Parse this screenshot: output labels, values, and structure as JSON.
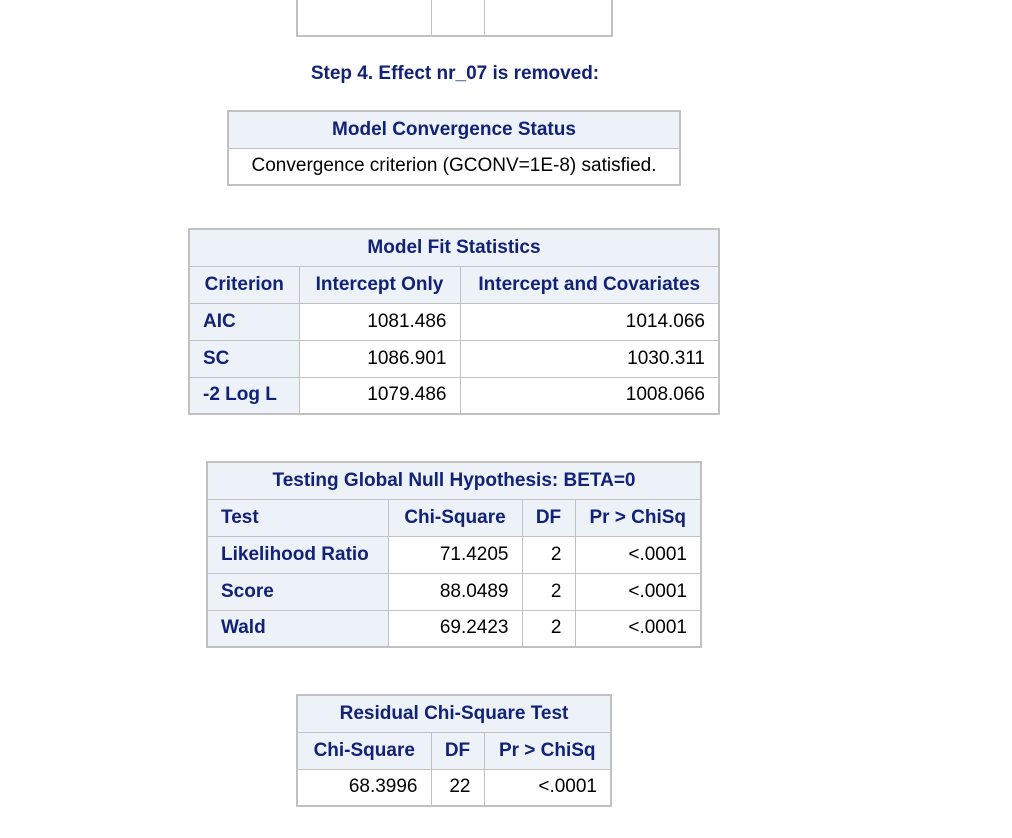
{
  "step_title": "Step 4. Effect nr_07 is removed:",
  "convergence": {
    "title": "Model Convergence Status",
    "message": "Convergence criterion (GCONV=1E-8) satisfied."
  },
  "fit_stats": {
    "title": "Model Fit Statistics",
    "headers": [
      "Criterion",
      "Intercept Only",
      "Intercept and Covariates"
    ],
    "rows": [
      {
        "criterion": "AIC",
        "intercept_only": "1081.486",
        "intercept_and_covariates": "1014.066"
      },
      {
        "criterion": "SC",
        "intercept_only": "1086.901",
        "intercept_and_covariates": "1030.311"
      },
      {
        "criterion": "-2 Log L",
        "intercept_only": "1079.486",
        "intercept_and_covariates": "1008.066"
      }
    ]
  },
  "global_null": {
    "title": "Testing Global Null Hypothesis: BETA=0",
    "headers": [
      "Test",
      "Chi-Square",
      "DF",
      "Pr > ChiSq"
    ],
    "rows": [
      {
        "test": "Likelihood Ratio",
        "chi_square": "71.4205",
        "df": "2",
        "p": "<.0001"
      },
      {
        "test": "Score",
        "chi_square": "88.0489",
        "df": "2",
        "p": "<.0001"
      },
      {
        "test": "Wald",
        "chi_square": "69.2423",
        "df": "2",
        "p": "<.0001"
      }
    ]
  },
  "residual": {
    "title": "Residual Chi-Square Test",
    "headers": [
      "Chi-Square",
      "DF",
      "Pr > ChiSq"
    ],
    "row": {
      "chi_square": "68.3996",
      "df": "22",
      "p": "<.0001"
    }
  }
}
